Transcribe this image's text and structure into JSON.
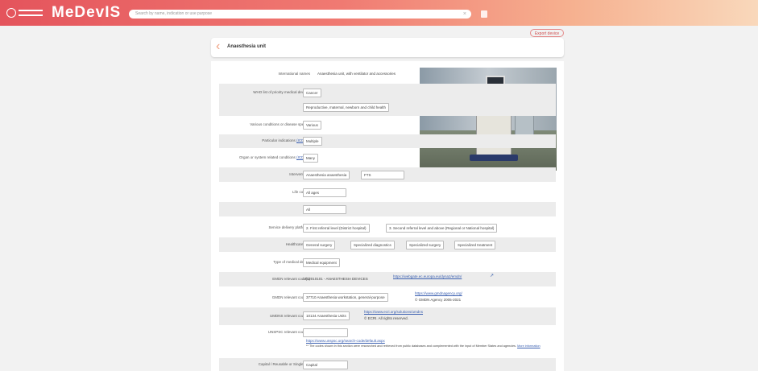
{
  "header": {
    "brand": "MeDevIS",
    "search_placeholder": "Search by name, indication or use purpose",
    "search_clear": "×"
  },
  "export_label": "Export device",
  "device": {
    "title": "Anaesthesia unit",
    "fields": [
      {
        "label": "International names",
        "value": "Anaesthesia unit, with ventilator and accessories"
      },
      {
        "label": "WHO list of priority medical devices",
        "chips": [
          "Cancer",
          "Reproductive, maternal, newborn and child health"
        ]
      },
      {
        "label": "Various conditions or disease specific",
        "chips": [
          "Various"
        ]
      },
      {
        "label": "Particular indications",
        "label_link": "(ICD-11)",
        "chips": [
          "Multiple"
        ]
      },
      {
        "label": "Organ or system related conditions",
        "label_link": "(ICD-11)",
        "chips": [
          "Many"
        ]
      },
      {
        "label": "Interventions",
        "chips": [
          "Anaesthesia anaesthesia",
          "FTS"
        ]
      },
      {
        "label": "Life course",
        "chips": [
          "All ages"
        ]
      },
      {
        "label": "Sex",
        "chips": [
          "All"
        ]
      },
      {
        "label": "Service delivery platforms",
        "chips": [
          "2. First referral level (District hospital)",
          "3. Second referral level and above (Regional or National hospital)"
        ]
      },
      {
        "label": "Healthcare unit",
        "chips": [
          "General surgery",
          "Specialized diagnostics",
          "Specialized surgery",
          "Specialized treatment"
        ]
      },
      {
        "label": "Type of medical device",
        "chips": [
          "Medical equipment"
        ]
      },
      {
        "label": "EMDN relevant code(s)",
        "value": "Z12010101 - ANAESTHESIA DEVICES",
        "link": "https://webgate.ec.europa.eu/dyna2/emdn/"
      },
      {
        "label": "GMDN relevant code(s)",
        "chips": [
          "37710 Anaesthesia workstation, general-purpose"
        ],
        "link": "https://www.gmdnagency.org/",
        "note": "© GMDN Agency 2005-2021"
      },
      {
        "label": "UMDNS relevant code(s)",
        "chips": [
          "10134 Anaesthesia Units"
        ],
        "link": "https://www.ecri.org/solutions/umdns",
        "note": "© ECRI. All rights reserved."
      },
      {
        "label": "UNSPSC relevant code(s)",
        "chips": [
          ""
        ],
        "link": "https://www.unspsc.org/search-code/default.aspx",
        "note": "** The codes shown in this section were researched and retrieved from public databases and complemented with the input of Member States and agencies.",
        "note_link": "More information"
      },
      {
        "label": "Capital / Reusable or Single use",
        "chips": [
          "Capital"
        ]
      }
    ]
  },
  "colors": {
    "header_start": "#e4545c",
    "header_end": "#f9d8bb",
    "link": "#3a5fb0"
  },
  "icons": {
    "back": "chevron-left-icon",
    "search_button": "menu-icon",
    "external": "external-link-icon"
  }
}
